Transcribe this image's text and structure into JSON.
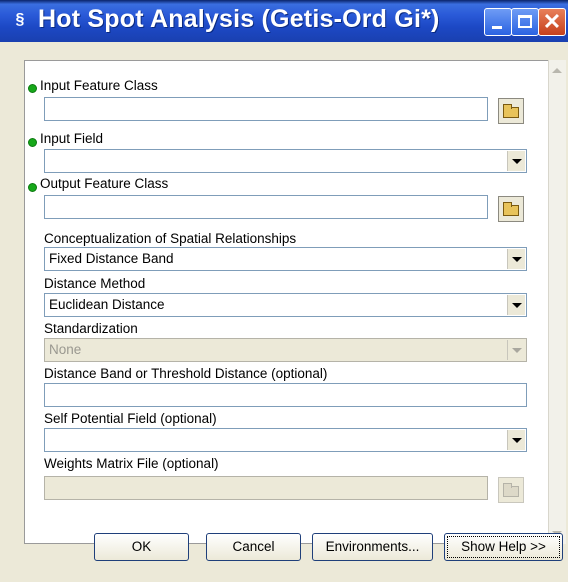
{
  "window": {
    "title": "Hot Spot Analysis (Getis-Ord Gi*)"
  },
  "icons": {
    "app": "tool-icon",
    "minimize": "minimize-icon",
    "maximize": "maximize-icon",
    "close": "close-icon",
    "browse": "folder-open-icon",
    "dropdown": "chevron-down-icon",
    "required": "required-dot-icon"
  },
  "form": {
    "input_feature_class": {
      "label": "Input Feature Class",
      "value": ""
    },
    "input_field": {
      "label": "Input Field",
      "value": ""
    },
    "output_feature_class": {
      "label": "Output Feature Class",
      "value": ""
    },
    "conceptualization": {
      "label": "Conceptualization of Spatial Relationships",
      "value": "Fixed Distance Band"
    },
    "distance_method": {
      "label": "Distance Method",
      "value": "Euclidean Distance"
    },
    "standardization": {
      "label": "Standardization",
      "value": "None"
    },
    "distance_band": {
      "label": "Distance Band or Threshold Distance (optional)",
      "value": ""
    },
    "self_potential": {
      "label": "Self Potential Field (optional)",
      "value": ""
    },
    "weights_matrix": {
      "label": "Weights Matrix File (optional)",
      "value": ""
    }
  },
  "buttons": {
    "ok": "OK",
    "cancel": "Cancel",
    "environments": "Environments...",
    "show_help": "Show Help >>"
  },
  "colors": {
    "title_bar": "#2a5ad8",
    "required_dot": "#16a81a",
    "close_button": "#c6401c"
  }
}
